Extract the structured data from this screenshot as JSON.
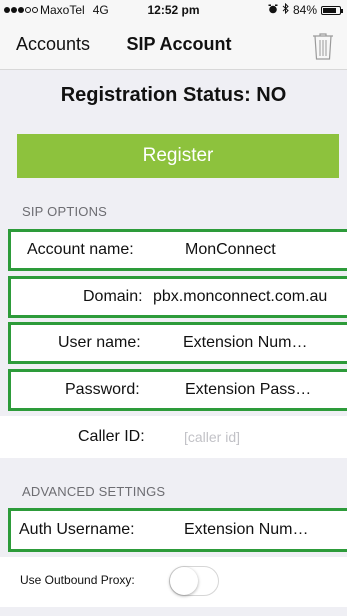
{
  "status_bar": {
    "carrier": "MaxoTel",
    "network": "4G",
    "time": "12:52 pm",
    "battery": "84%",
    "battery_level": 0.84
  },
  "nav": {
    "back_label": "Accounts",
    "title": "SIP Account",
    "right_icon": "trash-icon"
  },
  "registration": {
    "status_text": "Registration Status: NO",
    "register_label": "Register",
    "button_color": "#8dc23d"
  },
  "sip_options": {
    "header": "SIP OPTIONS",
    "account_name": {
      "label": "Account name:",
      "value": "MonConnect"
    },
    "domain": {
      "label": "Domain:",
      "value": "pbx.monconnect.com.au"
    },
    "user_name": {
      "label": "User name:",
      "value": "Extension Num…"
    },
    "password": {
      "label": "Password:",
      "value": "Extension Pass…"
    },
    "caller_id": {
      "label": "Caller ID:",
      "placeholder": "[caller id]"
    }
  },
  "advanced": {
    "header": "ADVANCED SETTINGS",
    "auth_username": {
      "label": "Auth Username:",
      "value": "Extension Num…"
    },
    "outbound_proxy": {
      "label": "Use Outbound Proxy:",
      "enabled": false
    }
  },
  "colors": {
    "highlight_border": "#2d9b3a",
    "background": "#efeff4"
  }
}
